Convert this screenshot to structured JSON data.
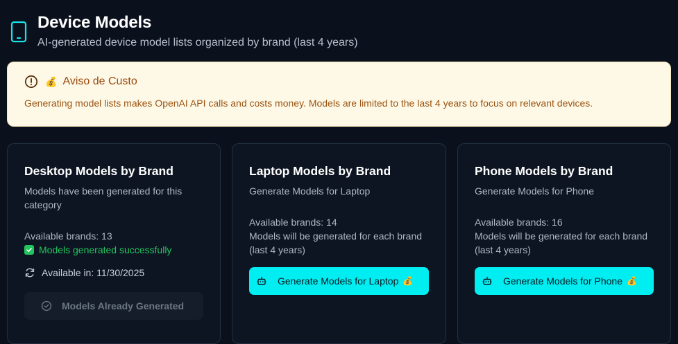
{
  "header": {
    "icon": "tablet-icon",
    "title": "Device Models",
    "subtitle": "AI-generated device model lists organized by brand (last 4 years)"
  },
  "warning": {
    "icon": "alert-circle-icon",
    "emoji": "💰",
    "title": "Aviso de Custo",
    "text": "Generating model lists makes OpenAI API calls and costs money. Models are limited to the last 4 years to focus on relevant devices."
  },
  "cards": [
    {
      "title": "Desktop Models by Brand",
      "description": "Models have been generated for this category",
      "brands": "Available brands: 13",
      "status": "Models generated successfully",
      "available_in": "Available in: 11/30/2025",
      "button": "Models Already Generated"
    },
    {
      "title": "Laptop Models by Brand",
      "description": "Generate Models for Laptop",
      "brands": "Available brands: 14",
      "note": "Models will be generated for each brand (last 4 years)",
      "button": "Generate Models for Laptop",
      "button_emoji": "💰"
    },
    {
      "title": "Phone Models by Brand",
      "description": "Generate Models for Phone",
      "brands": "Available brands: 16",
      "note": "Models will be generated for each brand (last 4 years)",
      "button": "Generate Models for Phone",
      "button_emoji": "💰"
    }
  ],
  "colors": {
    "background": "#0b111c",
    "accent": "#00eef2",
    "success": "#22c55e",
    "warning_bg": "#fef9e6",
    "warning_text": "#9a4b12"
  }
}
